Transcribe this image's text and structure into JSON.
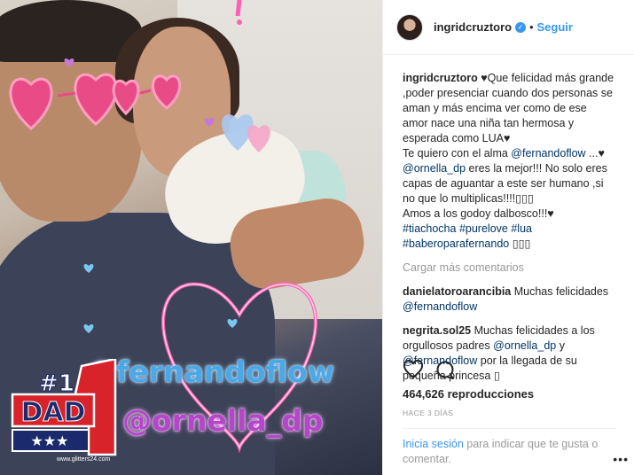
{
  "media": {
    "tag_fernando": "@fernandoflow",
    "tag_ornella": "@ornella_dp",
    "watermark": "www.glitters24.com",
    "dad_number": "#1",
    "dad_word": "DAD"
  },
  "header": {
    "username": "ingridcruztoro",
    "separator": "•",
    "follow_label": "Seguir"
  },
  "caption": {
    "username": "ingridcruztoro",
    "text1": " ♥Que felicidad más grande ,poder presenciar cuando dos personas se aman y más encima ver como de ese amor nace una niña tan hermosa y esperada como LUA♥",
    "text2": "Te quiero con el alma ",
    "mention1": "@fernandoflow",
    "text3": " ...♥",
    "mention2": "@ornella_dp",
    "text4": " eres la mejor!!! No solo eres capas de aguantar a este ser humano ,si no que lo multiplicas!!!!▯▯▯",
    "text5": "Amos a los godoy dalbosco!!!♥",
    "hashtag1": "#tiachocha",
    "hashtag2": "#purelove",
    "hashtag3": "#lua",
    "hashtag4": "#baberoparafernando",
    "text6": " ▯▯▯"
  },
  "load_more": "Cargar más comentarios",
  "comments": [
    {
      "user": "danielatoroarancibia",
      "text": " Muchas felicidades ",
      "mention": "@fernandoflow"
    },
    {
      "user": "negrita.sol25",
      "text": " Muchas felicidades a los orgullosos padres ",
      "mention": "@ornella_dp",
      "text2": " y ",
      "mention2": "@fernandoflow",
      "text3": " por la llegada de su pequeña princesa ▯"
    }
  ],
  "views": "464,626 reproducciones",
  "date": "HACE 3 DÍAS",
  "login": {
    "link": "Inicia sesión",
    "text": " para indicar que te gusta o comentar."
  },
  "icons": [
    "heart-icon",
    "comment-icon",
    "more-options-icon",
    "verified-icon"
  ],
  "colors": {
    "accent": "#3897f0",
    "link": "#003569",
    "muted": "#999999"
  }
}
